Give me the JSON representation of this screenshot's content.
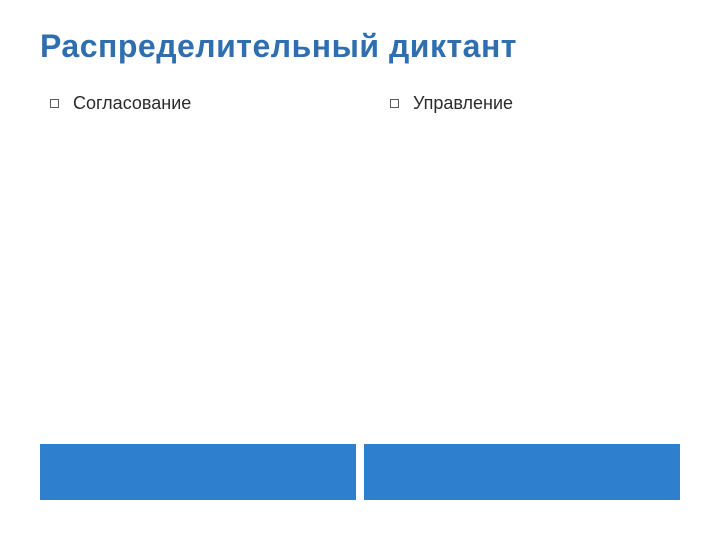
{
  "title": "Распределительный диктант",
  "columns": {
    "left": {
      "bullet": "Согласование"
    },
    "right": {
      "bullet": "Управление"
    }
  },
  "colors": {
    "title": "#2F6FAF",
    "bar": "#2F7FCF"
  }
}
